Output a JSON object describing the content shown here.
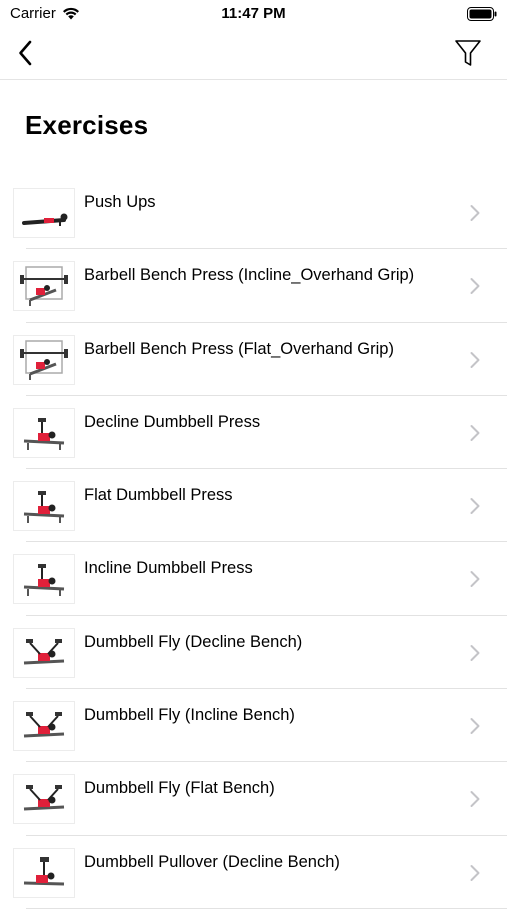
{
  "status": {
    "carrier": "Carrier",
    "time": "11:47 PM"
  },
  "nav": {
    "back_icon": "chevron-left-icon",
    "filter_icon": "filter-icon"
  },
  "page": {
    "title": "Exercises"
  },
  "exercises": [
    {
      "name": "Push Ups",
      "icon": "push-up-thumbnail"
    },
    {
      "name": "Barbell Bench Press (Incline_Overhand Grip)",
      "icon": "barbell-bench-thumbnail"
    },
    {
      "name": "Barbell Bench Press (Flat_Overhand Grip)",
      "icon": "barbell-bench-thumbnail"
    },
    {
      "name": "Decline Dumbbell Press",
      "icon": "dumbbell-press-thumbnail"
    },
    {
      "name": "Flat Dumbbell Press",
      "icon": "dumbbell-press-thumbnail"
    },
    {
      "name": "Incline Dumbbell Press",
      "icon": "dumbbell-press-thumbnail"
    },
    {
      "name": "Dumbbell Fly (Decline Bench)",
      "icon": "dumbbell-fly-thumbnail"
    },
    {
      "name": "Dumbbell Fly (Incline Bench)",
      "icon": "dumbbell-fly-thumbnail"
    },
    {
      "name": "Dumbbell Fly (Flat Bench)",
      "icon": "dumbbell-fly-thumbnail"
    },
    {
      "name": "Dumbbell Pullover (Decline Bench)",
      "icon": "dumbbell-pullover-thumbnail"
    }
  ],
  "colors": {
    "accent_shirt": "#e0203a",
    "chevron": "#c4c4c8",
    "separator": "#e2e2e2"
  }
}
